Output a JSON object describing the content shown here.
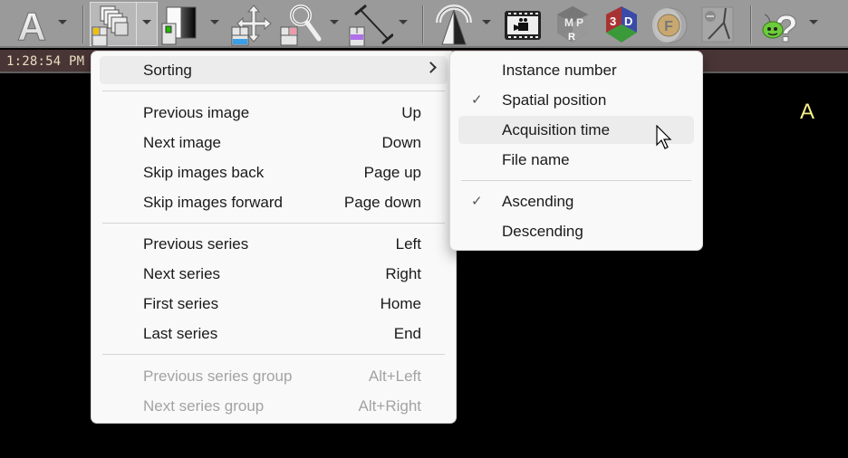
{
  "toolbar": {
    "items": [
      {
        "icon": "text-annotation-icon",
        "has_dropdown": true
      },
      {
        "icon": "image-stack-browse-icon",
        "has_dropdown": true,
        "active": true
      },
      {
        "icon": "window-level-icon",
        "has_dropdown": true
      },
      {
        "icon": "pan-move-icon",
        "has_dropdown": false
      },
      {
        "icon": "zoom-magnifier-icon",
        "has_dropdown": true
      },
      {
        "icon": "measure-ruler-icon",
        "has_dropdown": true
      },
      {
        "icon": "rotate-flip-icon",
        "has_dropdown": true
      },
      {
        "icon": "cine-film-icon",
        "has_dropdown": false
      },
      {
        "icon": "mpr-cube-icon",
        "has_dropdown": false,
        "text": "MPR"
      },
      {
        "icon": "3d-cube-icon",
        "has_dropdown": false,
        "text": "3D"
      },
      {
        "icon": "fusion-icon",
        "has_dropdown": false,
        "text": "F"
      },
      {
        "icon": "vessel-tool-icon",
        "has_dropdown": false
      },
      {
        "icon": "help-bug-icon",
        "has_dropdown": true
      }
    ]
  },
  "infobar": {
    "clock": "1:28:54 PM",
    "orientation_marker": "A"
  },
  "main_menu": {
    "groups": [
      [
        {
          "label": "Sorting",
          "shortcut": "",
          "submenu": true,
          "hover": true
        }
      ],
      [
        {
          "label": "Previous image",
          "shortcut": "Up"
        },
        {
          "label": "Next image",
          "shortcut": "Down"
        },
        {
          "label": "Skip images back",
          "shortcut": "Page up"
        },
        {
          "label": "Skip images forward",
          "shortcut": "Page down"
        }
      ],
      [
        {
          "label": "Previous series",
          "shortcut": "Left"
        },
        {
          "label": "Next series",
          "shortcut": "Right"
        },
        {
          "label": "First series",
          "shortcut": "Home"
        },
        {
          "label": "Last series",
          "shortcut": "End"
        }
      ],
      [
        {
          "label": "Previous series group",
          "shortcut": "Alt+Left",
          "disabled": true
        },
        {
          "label": "Next series group",
          "shortcut": "Alt+Right",
          "disabled": true
        }
      ]
    ]
  },
  "sorting_submenu": {
    "groups": [
      [
        {
          "label": "Instance number",
          "checked": false
        },
        {
          "label": "Spatial position",
          "checked": true
        },
        {
          "label": "Acquisition time",
          "checked": false,
          "hover": true
        },
        {
          "label": "File name",
          "checked": false
        }
      ],
      [
        {
          "label": "Ascending",
          "checked": true
        },
        {
          "label": "Descending",
          "checked": false
        }
      ]
    ],
    "check_glyph": "✓"
  },
  "colors": {
    "toolbar_bg": "#9a9a9a",
    "infobar_bg": "#493535",
    "menu_bg": "#f9f9f9",
    "menu_hover": "#ececec",
    "disabled_text": "#a3a3a3",
    "clock_text": "#e8dfc0",
    "orientation_text": "#f5ef8a"
  }
}
